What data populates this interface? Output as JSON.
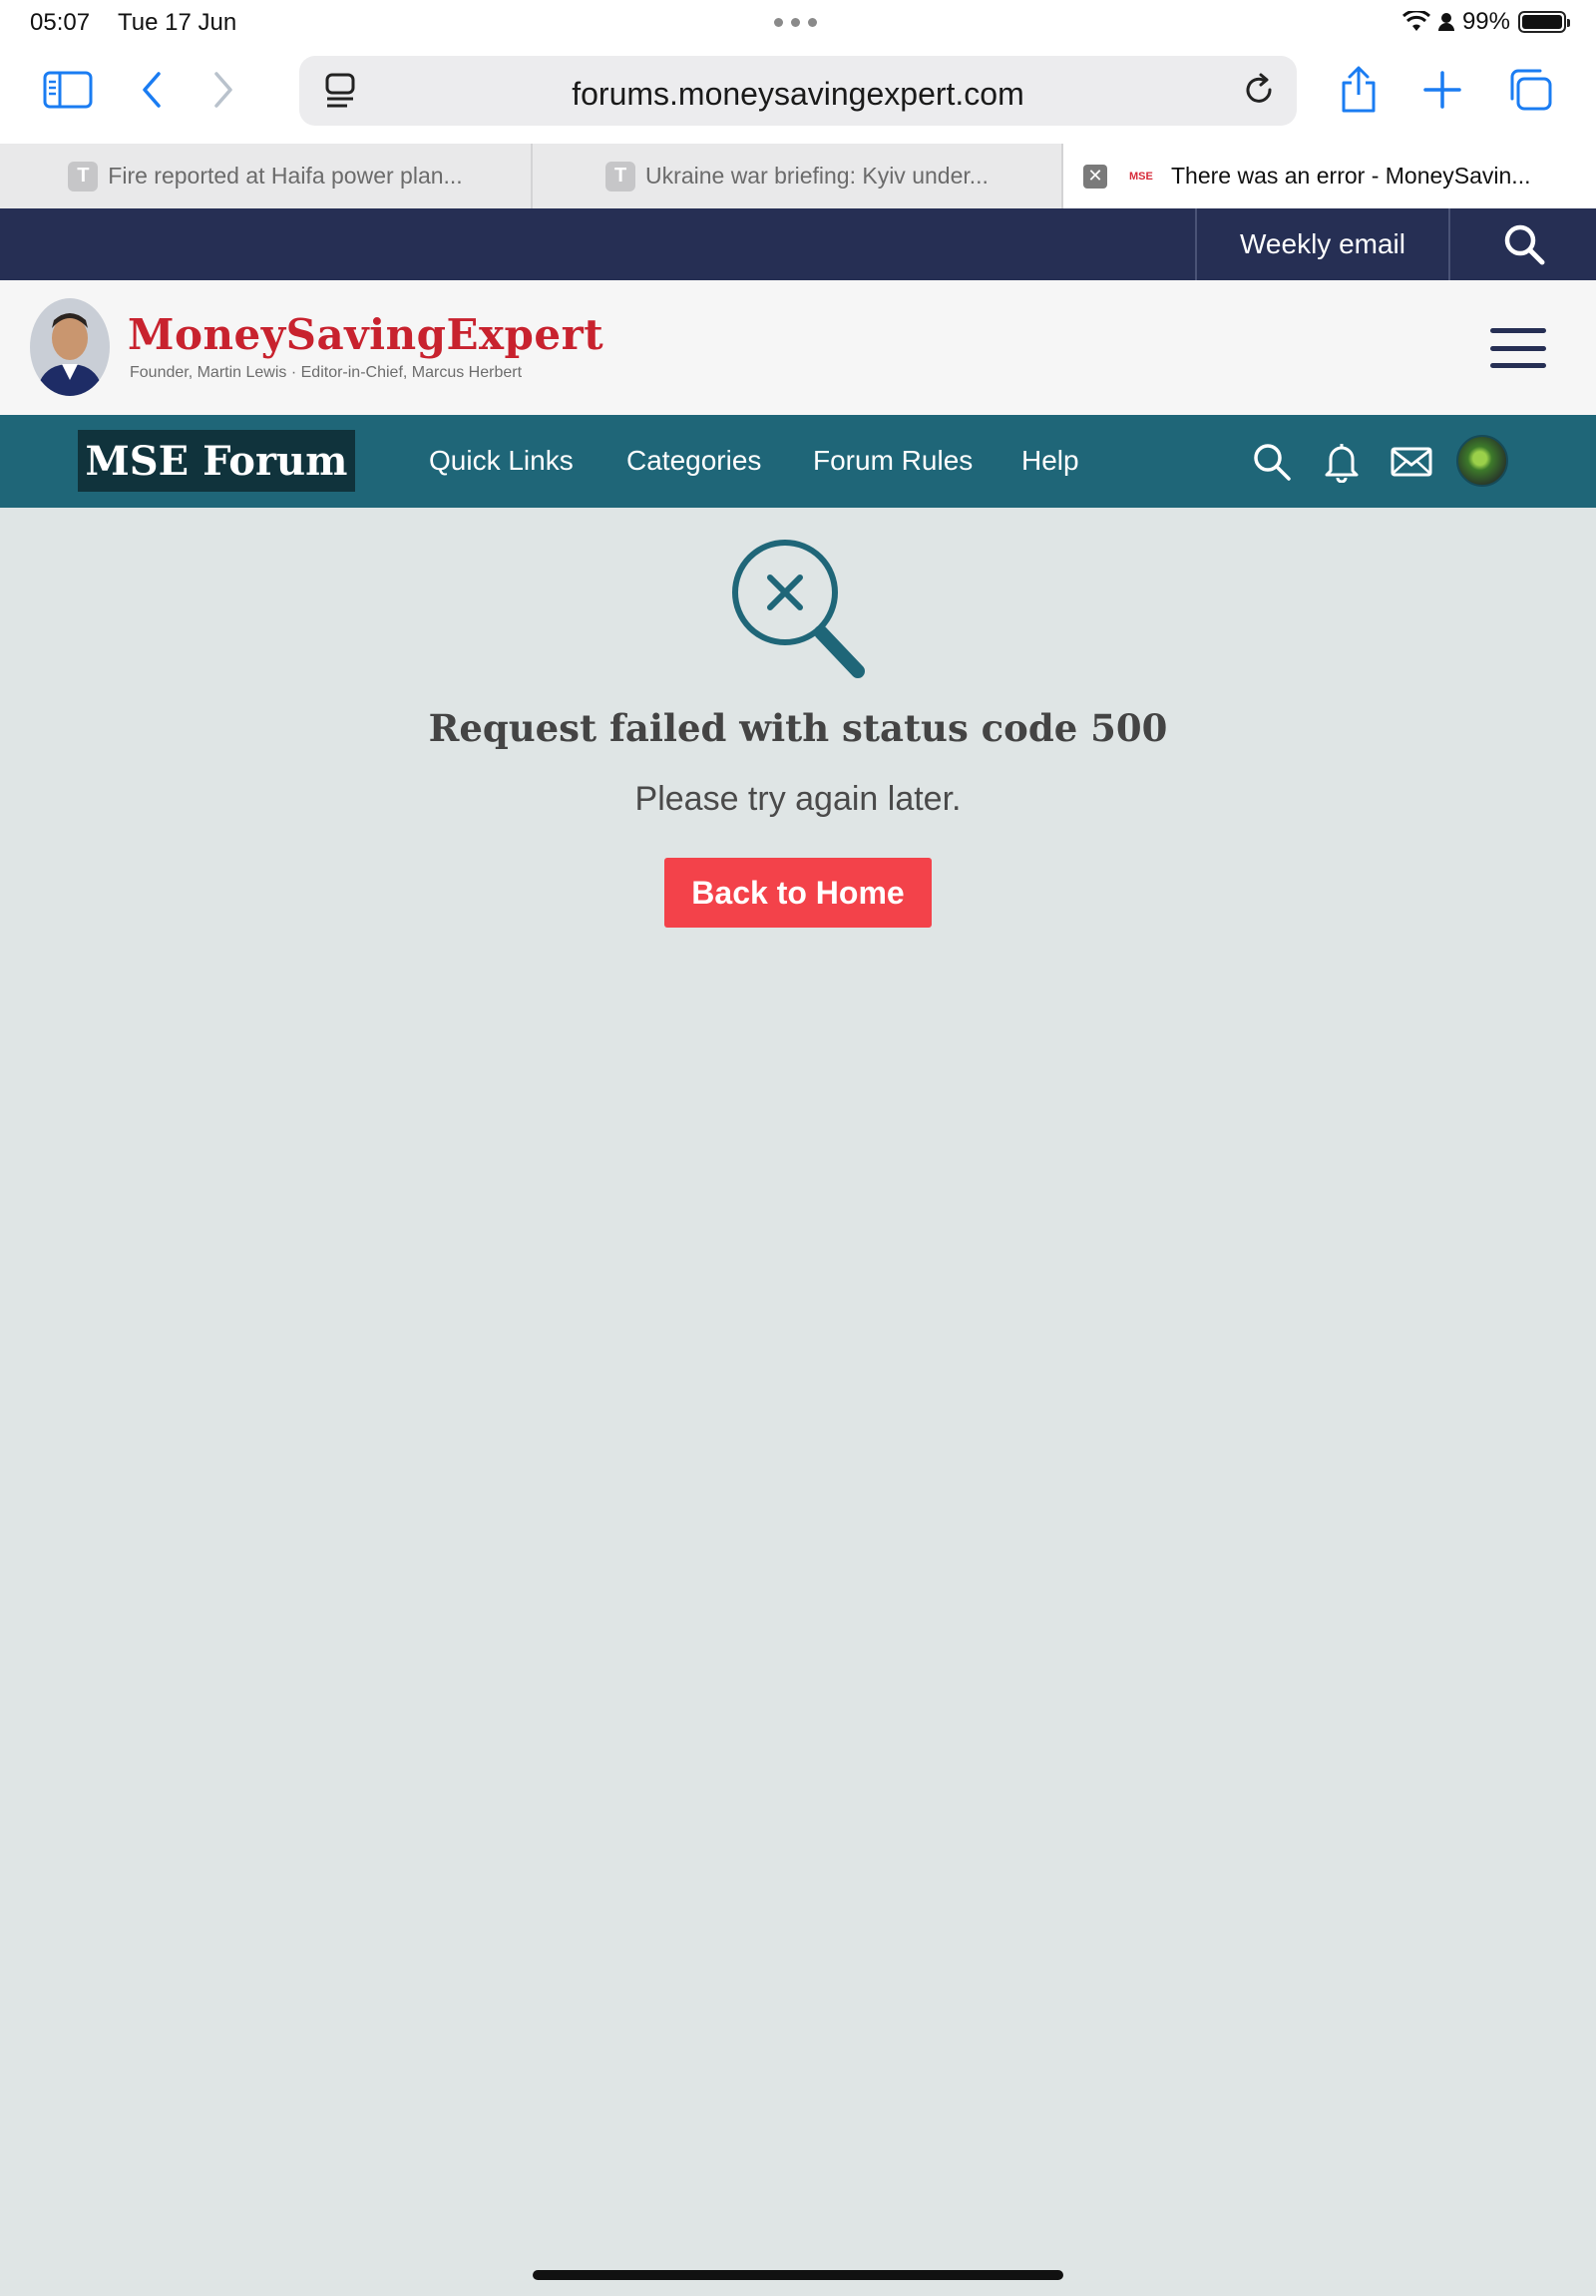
{
  "status_bar": {
    "time": "05:07",
    "date": "Tue 17 Jun",
    "battery": "99%",
    "battery_level": 0.99
  },
  "browser": {
    "url": "forums.moneysavingexpert.com",
    "icons": [
      "sidebar-icon",
      "back-icon",
      "forward-icon",
      "reader-icon",
      "reload-icon",
      "share-icon",
      "new-tab-icon",
      "tabs-icon"
    ],
    "tabs": [
      {
        "favicon": "T",
        "title": "Fire reported at Haifa power plan..."
      },
      {
        "favicon": "T",
        "title": "Ukraine war briefing: Kyiv under..."
      },
      {
        "favicon": "MSE",
        "title": "There was an error - MoneySavin..."
      }
    ]
  },
  "site_header": {
    "weekly_email": "Weekly email",
    "brand_name": "MoneySavingExpert",
    "brand_tagline": "Founder, Martin Lewis · Editor-in-Chief, Marcus Herbert",
    "brand_color": "#c8222e",
    "navy": "#262f54"
  },
  "forum_nav": {
    "logo": "MSE Forum",
    "links": [
      "Quick Links",
      "Categories",
      "Forum Rules",
      "Help"
    ],
    "icons": [
      "search-icon",
      "bell-icon",
      "mail-icon",
      "user-avatar"
    ],
    "bar_color": "#1f6678"
  },
  "error": {
    "title": "Request failed with status code 500",
    "message": "Please try again later.",
    "button": "Back to Home",
    "button_color": "#f3424a"
  }
}
